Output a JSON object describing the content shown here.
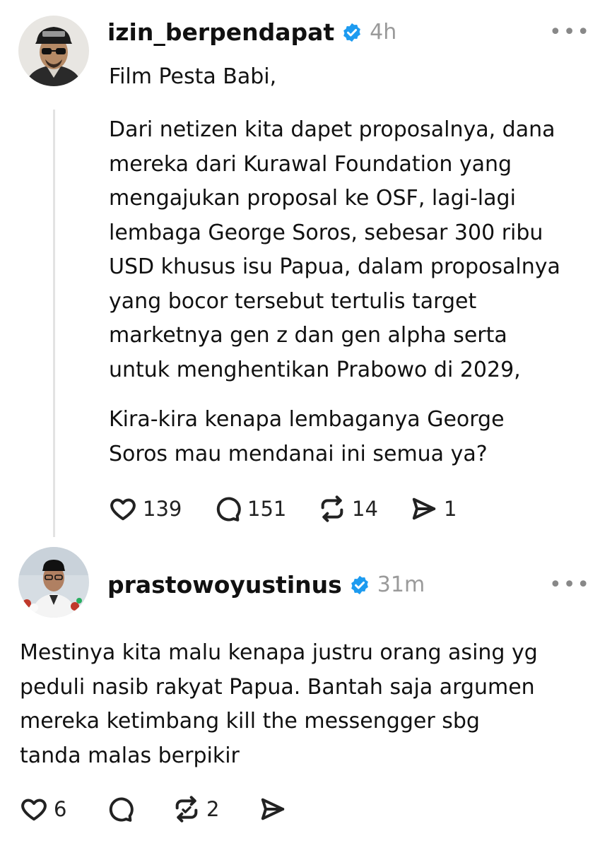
{
  "post": {
    "username": "izin_berpendapat",
    "time": "4h",
    "more_label": "•••",
    "paragraph1": "Film Pesta Babi,",
    "paragraph2": "Dari netizen kita dapet proposalnya, dana\nmereka dari Kurawal Foundation yang\nmengajukan proposal ke OSF, lagi-lagi\nlembaga George Soros, sebesar 300 ribu\nUSD khusus isu Papua, dalam proposalnya\nyang bocor tersebut tertulis target\nmarketnya gen z dan gen alpha serta\nuntuk menghentikan Prabowo di 2029,",
    "paragraph3": "Kira-kira kenapa lembaganya George\nSoros mau mendanai ini semua ya?",
    "likes": "139",
    "comments": "151",
    "reposts": "14",
    "shares": "1"
  },
  "reply": {
    "username": "prastowoyustinus",
    "time": "31m",
    "more_label": "•••",
    "text": "Mestinya kita malu kenapa justru orang asing yg\npeduli nasib rakyat Papua. Bantah saja argumen\nmereka ketimbang kill the messengger sbg\ntanda malas berpikir",
    "likes": "6",
    "reposts": "2"
  },
  "colors": {
    "verified": "#1d9bf0",
    "text": "#111111",
    "muted": "#9a9a9a",
    "thread_line": "#e3e3e3"
  },
  "icons": [
    "heart-icon",
    "comment-icon",
    "repost-icon",
    "share-icon",
    "verified-badge-icon",
    "more-icon"
  ]
}
